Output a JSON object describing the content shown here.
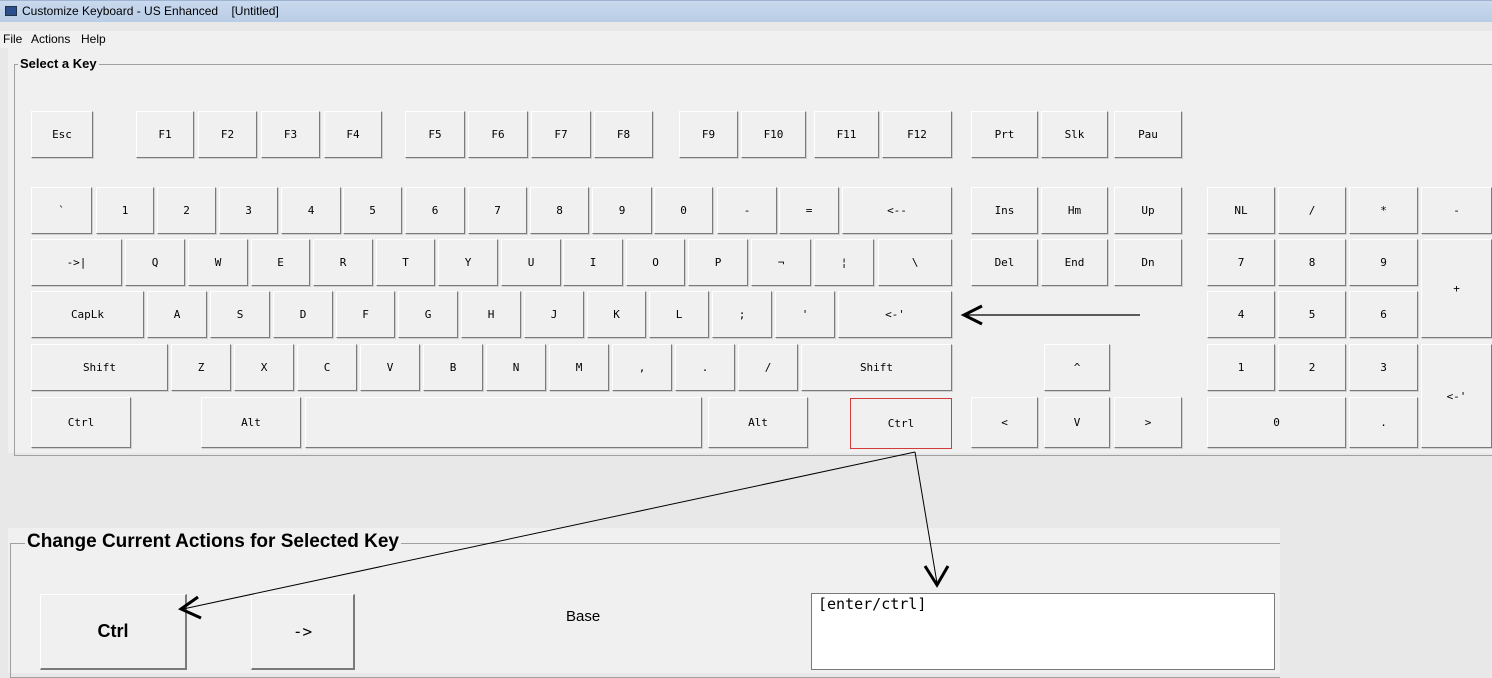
{
  "window": {
    "title": "Customize Keyboard - US Enhanced    [Untitled]"
  },
  "menu": [
    "File",
    "Actions",
    "Help"
  ],
  "keyboard_group": {
    "label": "Select a Key"
  },
  "keys": {
    "esc": "Esc",
    "f1": "F1",
    "f2": "F2",
    "f3": "F3",
    "f4": "F4",
    "f5": "F5",
    "f6": "F6",
    "f7": "F7",
    "f8": "F8",
    "f9": "F9",
    "f10": "F10",
    "f11": "F11",
    "f12": "F12",
    "prt": "Prt",
    "slk": "Slk",
    "pau": "Pau",
    "backtick": "`",
    "n1": "1",
    "n2": "2",
    "n3": "3",
    "n4": "4",
    "n5": "5",
    "n6": "6",
    "n7": "7",
    "n8": "8",
    "n9": "9",
    "n0": "0",
    "minus": "-",
    "equals": "=",
    "backspace": "<--",
    "tab": "->|",
    "q": "Q",
    "w": "W",
    "e": "E",
    "r": "R",
    "t": "T",
    "y": "Y",
    "u": "U",
    "i": "I",
    "o": "O",
    "p": "P",
    "lbracket": "¬",
    "rbracket": "¦",
    "backslash": "\\",
    "caplk": "CapLk",
    "a": "A",
    "s": "S",
    "d": "D",
    "f": "F",
    "g": "G",
    "h": "H",
    "j": "J",
    "k": "K",
    "l": "L",
    "semicolon": ";",
    "quote": "'",
    "enter": "<-'",
    "lshift": "Shift",
    "z": "Z",
    "x": "X",
    "c": "C",
    "v": "V",
    "b": "B",
    "n": "N",
    "m": "M",
    "comma": ",",
    "period": ".",
    "slash": "/",
    "rshift": "Shift",
    "lctrl": "Ctrl",
    "lalt": "Alt",
    "space": "",
    "ralt": "Alt",
    "rctrl": "Ctrl",
    "ins": "Ins",
    "hm": "Hm",
    "up": "Up",
    "del": "Del",
    "end": "End",
    "dn": "Dn",
    "arrow_up": "^",
    "arrow_left": "<",
    "arrow_down": "V",
    "arrow_right": ">",
    "numlock": "NL",
    "np_slash": "/",
    "np_star": "*",
    "np_minus": "-",
    "np7": "7",
    "np8": "8",
    "np9": "9",
    "np_plus": "+",
    "np4": "4",
    "np5": "5",
    "np6": "6",
    "np1": "1",
    "np2": "2",
    "np3": "3",
    "np_enter": "<-'",
    "np0": "0",
    "np_dot": "."
  },
  "selected_key": "rctrl",
  "actions_group": {
    "label": "Change Current Actions for Selected Key"
  },
  "actions": {
    "key_button": "Ctrl",
    "next_button": "->",
    "state_label": "Base",
    "action_value": "[enter/ctrl]"
  },
  "colors": {
    "selected_border": "#d33a3a",
    "titlebar": "#c9d9ee"
  }
}
